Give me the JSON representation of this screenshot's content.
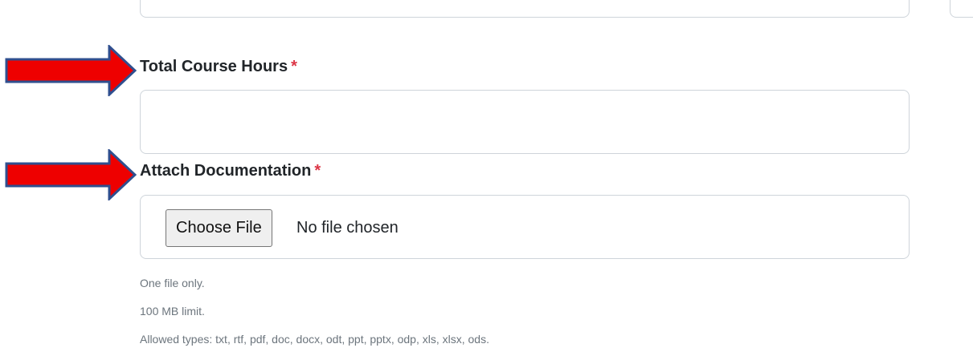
{
  "fields": {
    "hours": {
      "label": "Total Course Hours",
      "required_mark": "*",
      "value": ""
    },
    "attach": {
      "label": "Attach Documentation",
      "required_mark": "*",
      "button_label": "Choose File",
      "status": "No file chosen"
    }
  },
  "help": {
    "line1": "One file only.",
    "line2": "100 MB limit.",
    "line3": "Allowed types: txt, rtf, pdf, doc, docx, odt, ppt, pptx, odp, xls, xlsx, ods."
  },
  "colors": {
    "arrow_fill": "#ee0000",
    "arrow_stroke": "#2f4f8f",
    "required": "#dc3545"
  },
  "icons": {
    "annotation_arrow": "right-arrow-icon"
  }
}
